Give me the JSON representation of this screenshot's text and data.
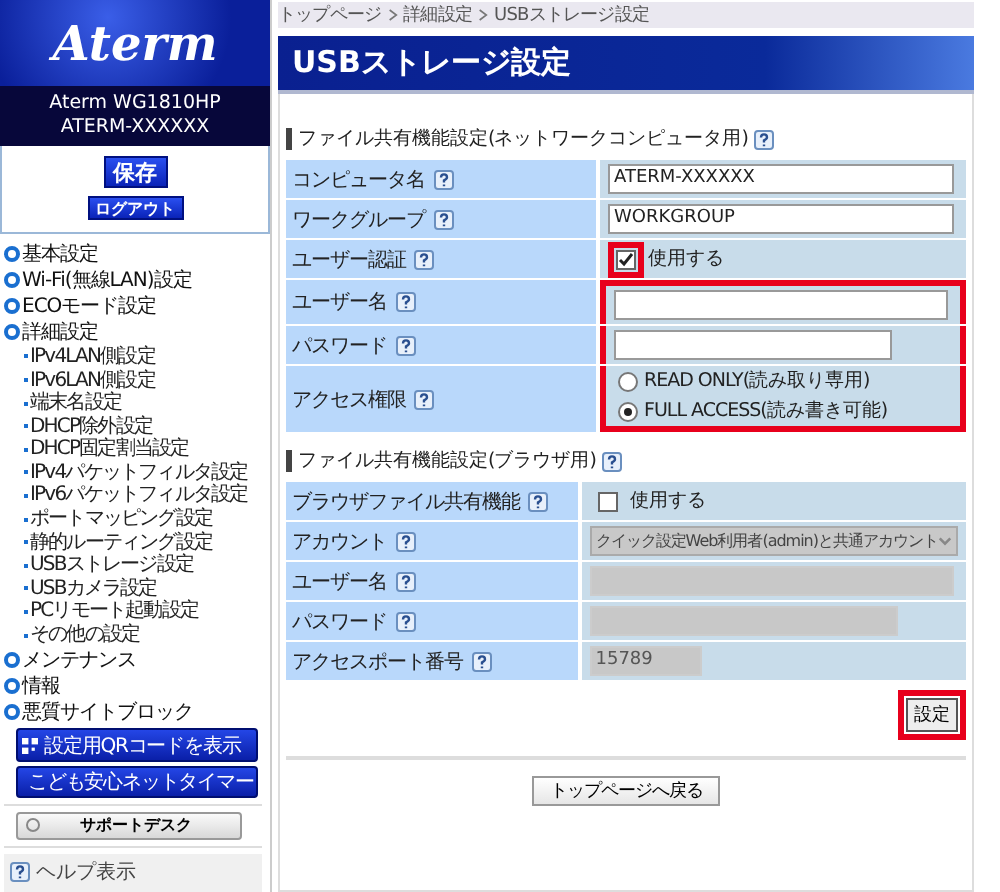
{
  "sidebar": {
    "logo": "Aterm",
    "model": "Aterm WG1810HP",
    "device": "ATERM-XXXXXX",
    "save_button": "保存",
    "logout_button": "ログアウト",
    "menu": [
      {
        "label": "基本設定"
      },
      {
        "label": "Wi-Fi(無線LAN)設定"
      },
      {
        "label": "ECOモード設定"
      },
      {
        "label": "詳細設定",
        "children": [
          {
            "label": "IPv4LAN側設定"
          },
          {
            "label": "IPv6LAN側設定"
          },
          {
            "label": "端末名設定"
          },
          {
            "label": "DHCP除外設定"
          },
          {
            "label": "DHCP固定割当設定"
          },
          {
            "label": "IPv4パケットフィルタ設定"
          },
          {
            "label": "IPv6パケットフィルタ設定"
          },
          {
            "label": "ポートマッピング設定"
          },
          {
            "label": "静的ルーティング設定"
          },
          {
            "label": "USBストレージ設定"
          },
          {
            "label": "USBカメラ設定"
          },
          {
            "label": "PCリモート起動設定"
          },
          {
            "label": "その他の設定"
          }
        ]
      },
      {
        "label": "メンテナンス"
      },
      {
        "label": "情報"
      },
      {
        "label": "悪質サイトブロック"
      }
    ],
    "qr_button": "設定用QRコードを表示",
    "timer_button": "こども安心ネットタイマー",
    "support_button": "サポートデスク",
    "help": "ヘルプ表示"
  },
  "breadcrumb": [
    "トップページ",
    "詳細設定",
    "USBストレージ設定"
  ],
  "page_title": "USBストレージ設定",
  "sections": [
    {
      "title": "ファイル共有機能設定(ネットワークコンピュータ用)",
      "disabled": false,
      "rows": [
        {
          "label": "コンピュータ名",
          "kind": "text",
          "value": "ATERM-XXXXXX",
          "highlighted": false
        },
        {
          "label": "ワークグループ",
          "kind": "text",
          "value": "WORKGROUP",
          "highlighted": false
        },
        {
          "label": "ユーザー認証",
          "kind": "checkbox",
          "option": "使用する",
          "checked": true,
          "highlighted": true
        },
        {
          "label": "ユーザー名",
          "kind": "text",
          "value": "",
          "highlighted": true
        },
        {
          "label": "パスワード",
          "kind": "password",
          "value": "",
          "highlighted": true
        },
        {
          "label": "アクセス権限",
          "kind": "radio",
          "highlighted": true,
          "options": [
            {
              "label": "READ ONLY(読み取り専用)",
              "selected": false
            },
            {
              "label": "FULL ACCESS(読み書き可能)",
              "selected": true
            }
          ]
        }
      ]
    },
    {
      "title": "ファイル共有機能設定(ブラウザ用)",
      "disabled": true,
      "rows": [
        {
          "label": "ブラウザファイル共有機能",
          "kind": "checkbox",
          "option": "使用する",
          "checked": false,
          "highlighted": false
        },
        {
          "label": "アカウント",
          "kind": "select",
          "value": "クイック設定Web利用者(admin)と共通アカウント",
          "highlighted": false
        },
        {
          "label": "ユーザー名",
          "kind": "text",
          "value": "",
          "highlighted": false
        },
        {
          "label": "パスワード",
          "kind": "password",
          "value": "",
          "highlighted": false
        },
        {
          "label": "アクセスポート番号",
          "kind": "port",
          "value": "15789",
          "highlighted": false
        }
      ]
    }
  ],
  "apply_button": {
    "label": "設定",
    "highlighted": true
  },
  "back_button": "トップページへ戻る"
}
